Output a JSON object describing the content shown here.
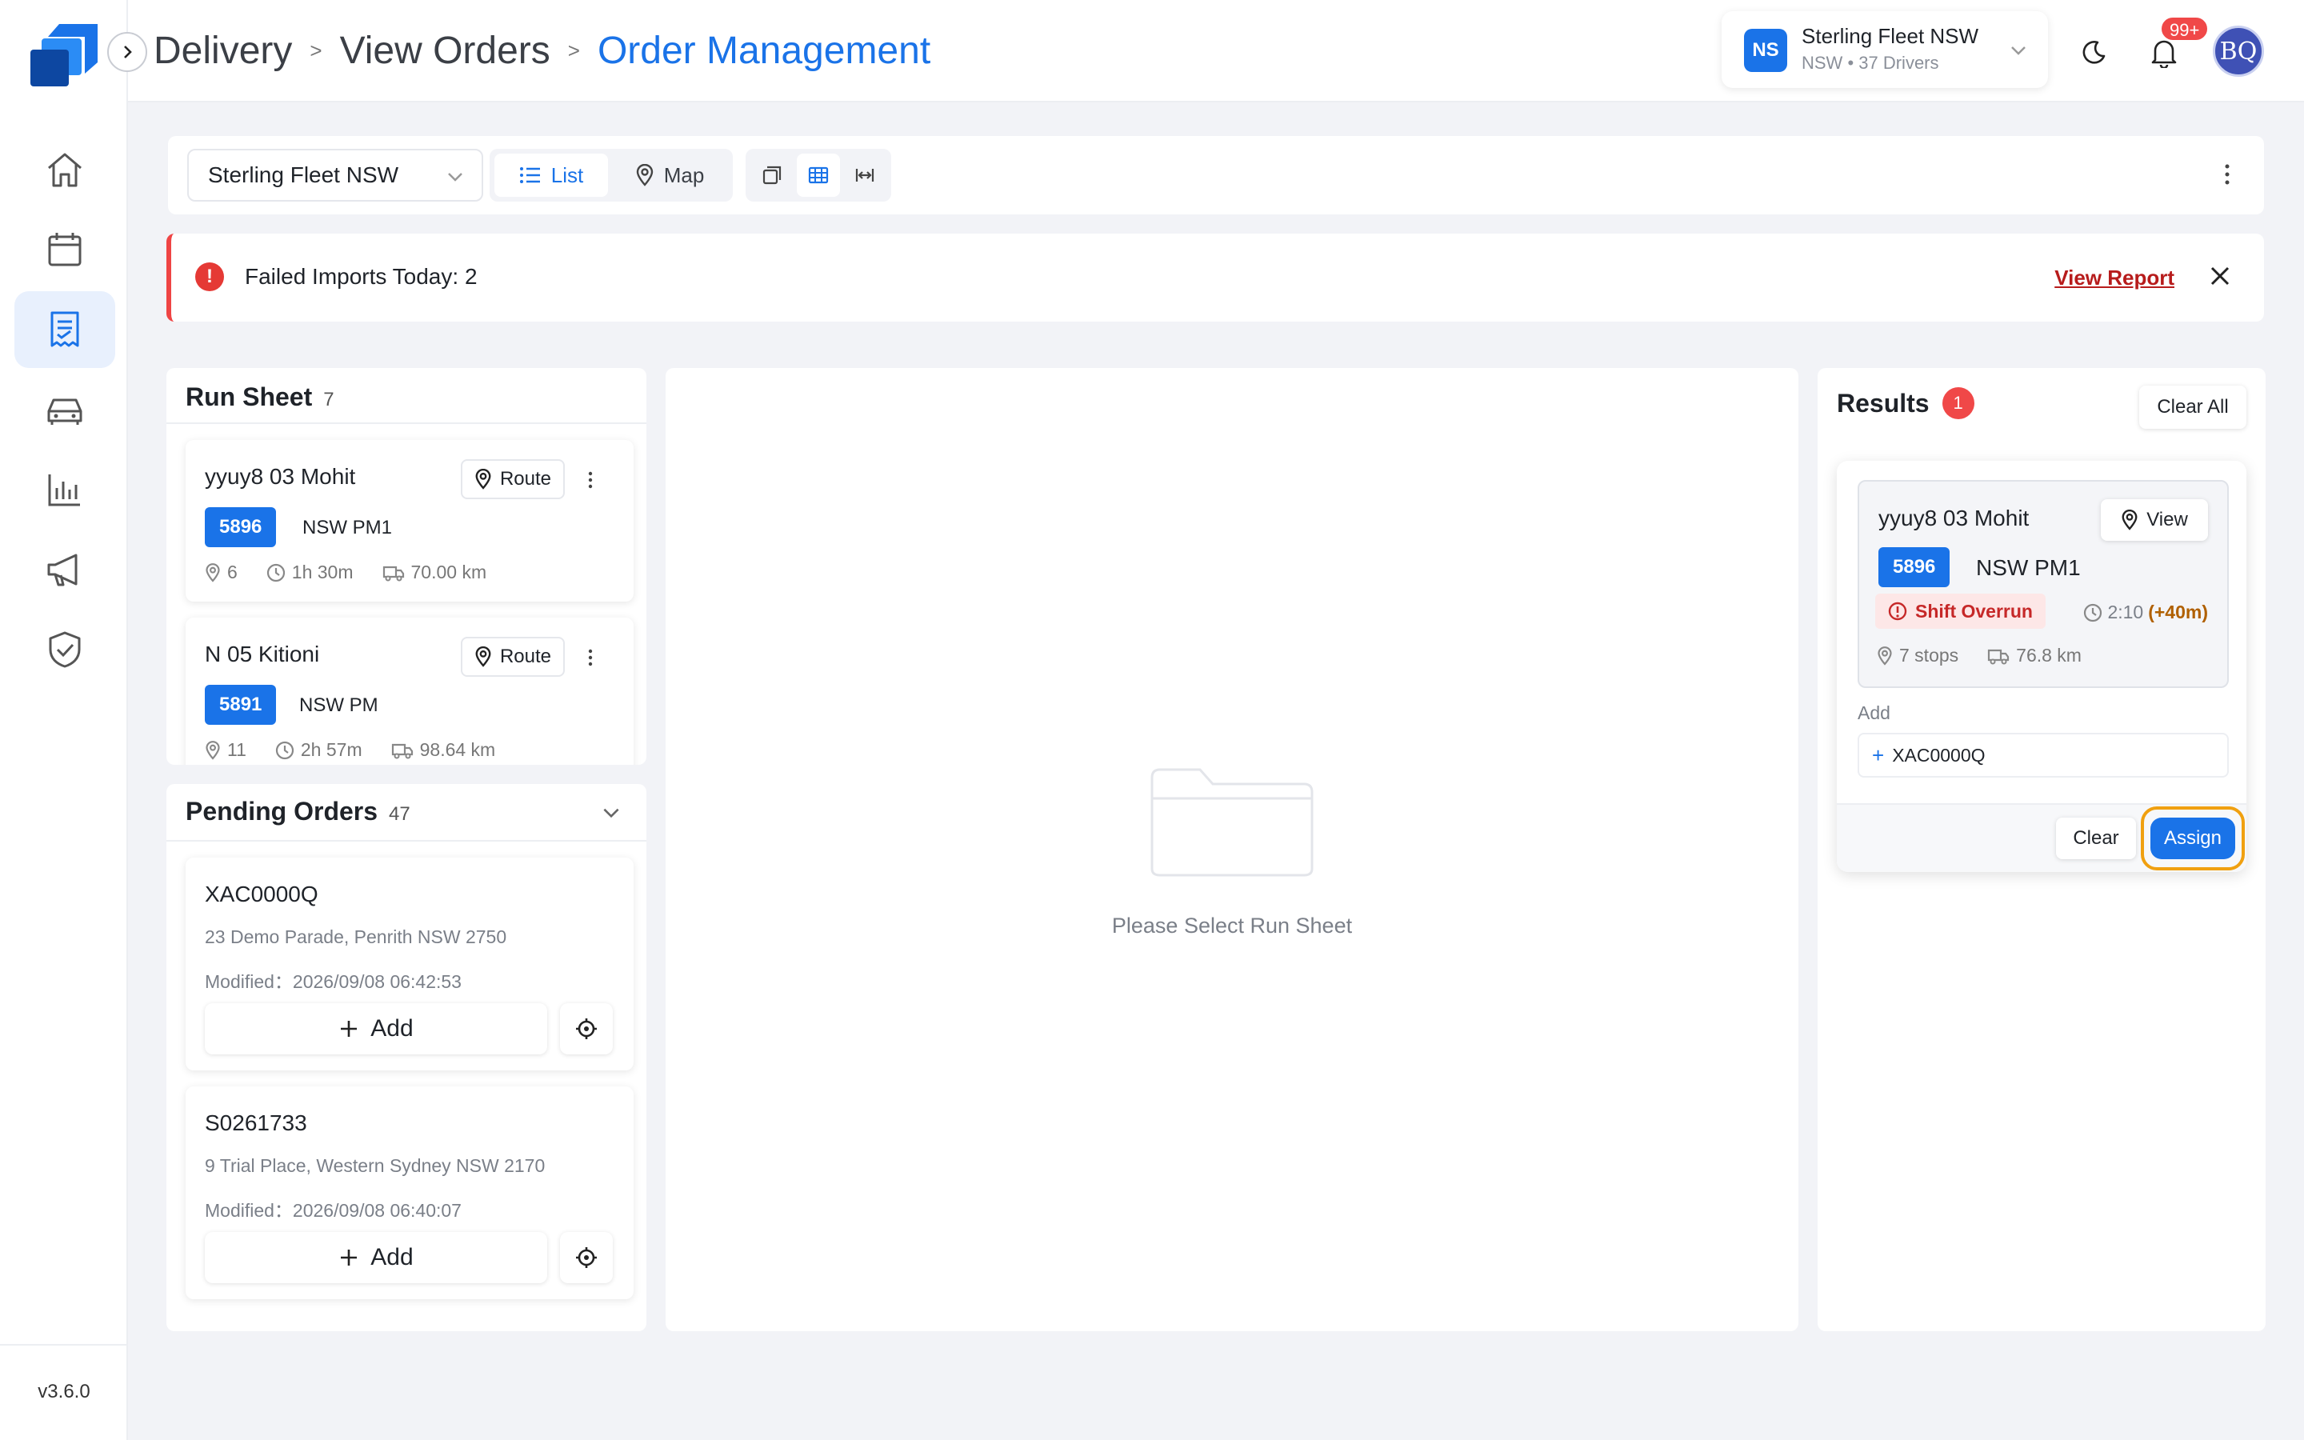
{
  "app": {
    "version": "v3.6.0"
  },
  "breadcrumb": {
    "items": [
      "Delivery",
      "View Orders"
    ],
    "current": "Order Management",
    "separator": ">"
  },
  "header": {
    "fleet": {
      "initials": "NS",
      "name": "Sterling Fleet NSW",
      "subtitle": "NSW • 37 Drivers"
    },
    "notifications_badge": "99+",
    "user_initials": "BQ"
  },
  "toolbar": {
    "fleet_select": "Sterling Fleet NSW",
    "view_options": [
      {
        "label": "List",
        "active": true
      },
      {
        "label": "Map",
        "active": false
      }
    ]
  },
  "alert": {
    "text": "Failed Imports Today: 2",
    "link": "View Report"
  },
  "run_sheet": {
    "title": "Run Sheet",
    "count": "7",
    "route_label": "Route",
    "items": [
      {
        "name": "yyuy8 03 Mohit",
        "run_id": "5896",
        "region": "NSW PM1",
        "stops": "6",
        "duration": "1h 30m",
        "distance": "70.00 km"
      },
      {
        "name": "N 05 Kitioni",
        "run_id": "5891",
        "region": "NSW PM",
        "stops": "11",
        "duration": "2h 57m",
        "distance": "98.64 km"
      }
    ]
  },
  "pending_orders": {
    "title": "Pending Orders",
    "count": "47",
    "add_label": "Add",
    "items": [
      {
        "id": "XAC0000Q",
        "address": "23 Demo Parade, Penrith NSW 2750",
        "modified": "Modified：2026/09/08 06:42:53"
      },
      {
        "id": "S0261733",
        "address": "9 Trial Place, Western Sydney NSW 2170",
        "modified": "Modified：2026/09/08 06:40:07"
      }
    ]
  },
  "main": {
    "empty_text": "Please Select Run Sheet"
  },
  "results": {
    "title": "Results",
    "count": "1",
    "clear_all": "Clear All",
    "card": {
      "name": "yyuy8 03 Mohit",
      "view_label": "View",
      "run_id": "5896",
      "region": "NSW PM1",
      "warning": "Shift Overrun",
      "time": "2:10",
      "time_extra": "(+40m)",
      "stops": "7 stops",
      "distance": "76.8 km"
    },
    "add_label": "Add",
    "added_order": "XAC0000Q",
    "clear": "Clear",
    "assign": "Assign"
  },
  "colors": {
    "accent": "#1a73e8",
    "danger": "#ef4444",
    "highlight": "#f0a010"
  }
}
